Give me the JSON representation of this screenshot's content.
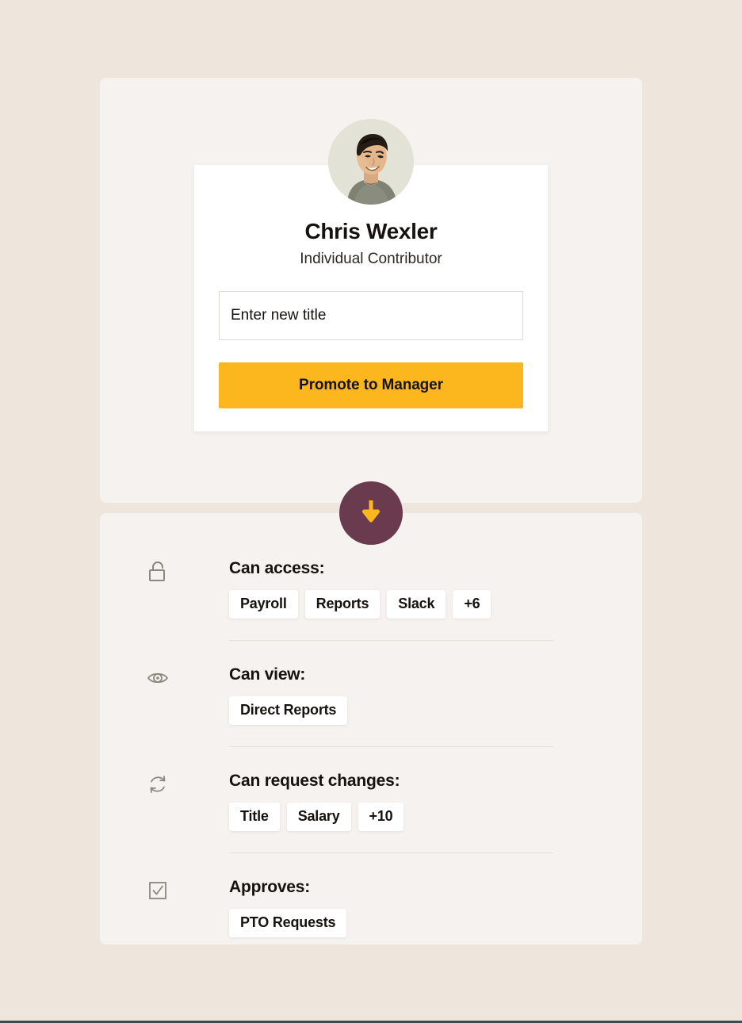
{
  "theme": {
    "page_background": "#EEE5DD",
    "panel_background": "#F6F2EF",
    "card_background": "#FFFFFF",
    "accent_yellow": "#FCB71F",
    "badge_plum": "#6A3A4E",
    "text_primary": "#15120F",
    "divider": "#E6E1D6",
    "avatar_background": "#E3E2D6"
  },
  "profile": {
    "avatar_icon": "user-photo-avatar",
    "name": "Chris Wexler",
    "role": "Individual Contributor",
    "title_input": {
      "placeholder": "Enter new title",
      "value": ""
    },
    "promote_label": "Promote to Manager"
  },
  "flow": {
    "badge_icon": "arrow-down-icon"
  },
  "permissions": {
    "rows": [
      {
        "icon": "unlock-icon",
        "label": "Can access:",
        "chips": [
          "Payroll",
          "Reports",
          "Slack",
          "+6"
        ]
      },
      {
        "icon": "eye-icon",
        "label": "Can view:",
        "chips": [
          "Direct Reports"
        ]
      },
      {
        "icon": "refresh-icon",
        "label": "Can request changes:",
        "chips": [
          "Title",
          "Salary",
          "+10"
        ]
      },
      {
        "icon": "checkbox-checked-icon",
        "label": "Approves:",
        "chips": [
          "PTO Requests"
        ]
      }
    ]
  }
}
